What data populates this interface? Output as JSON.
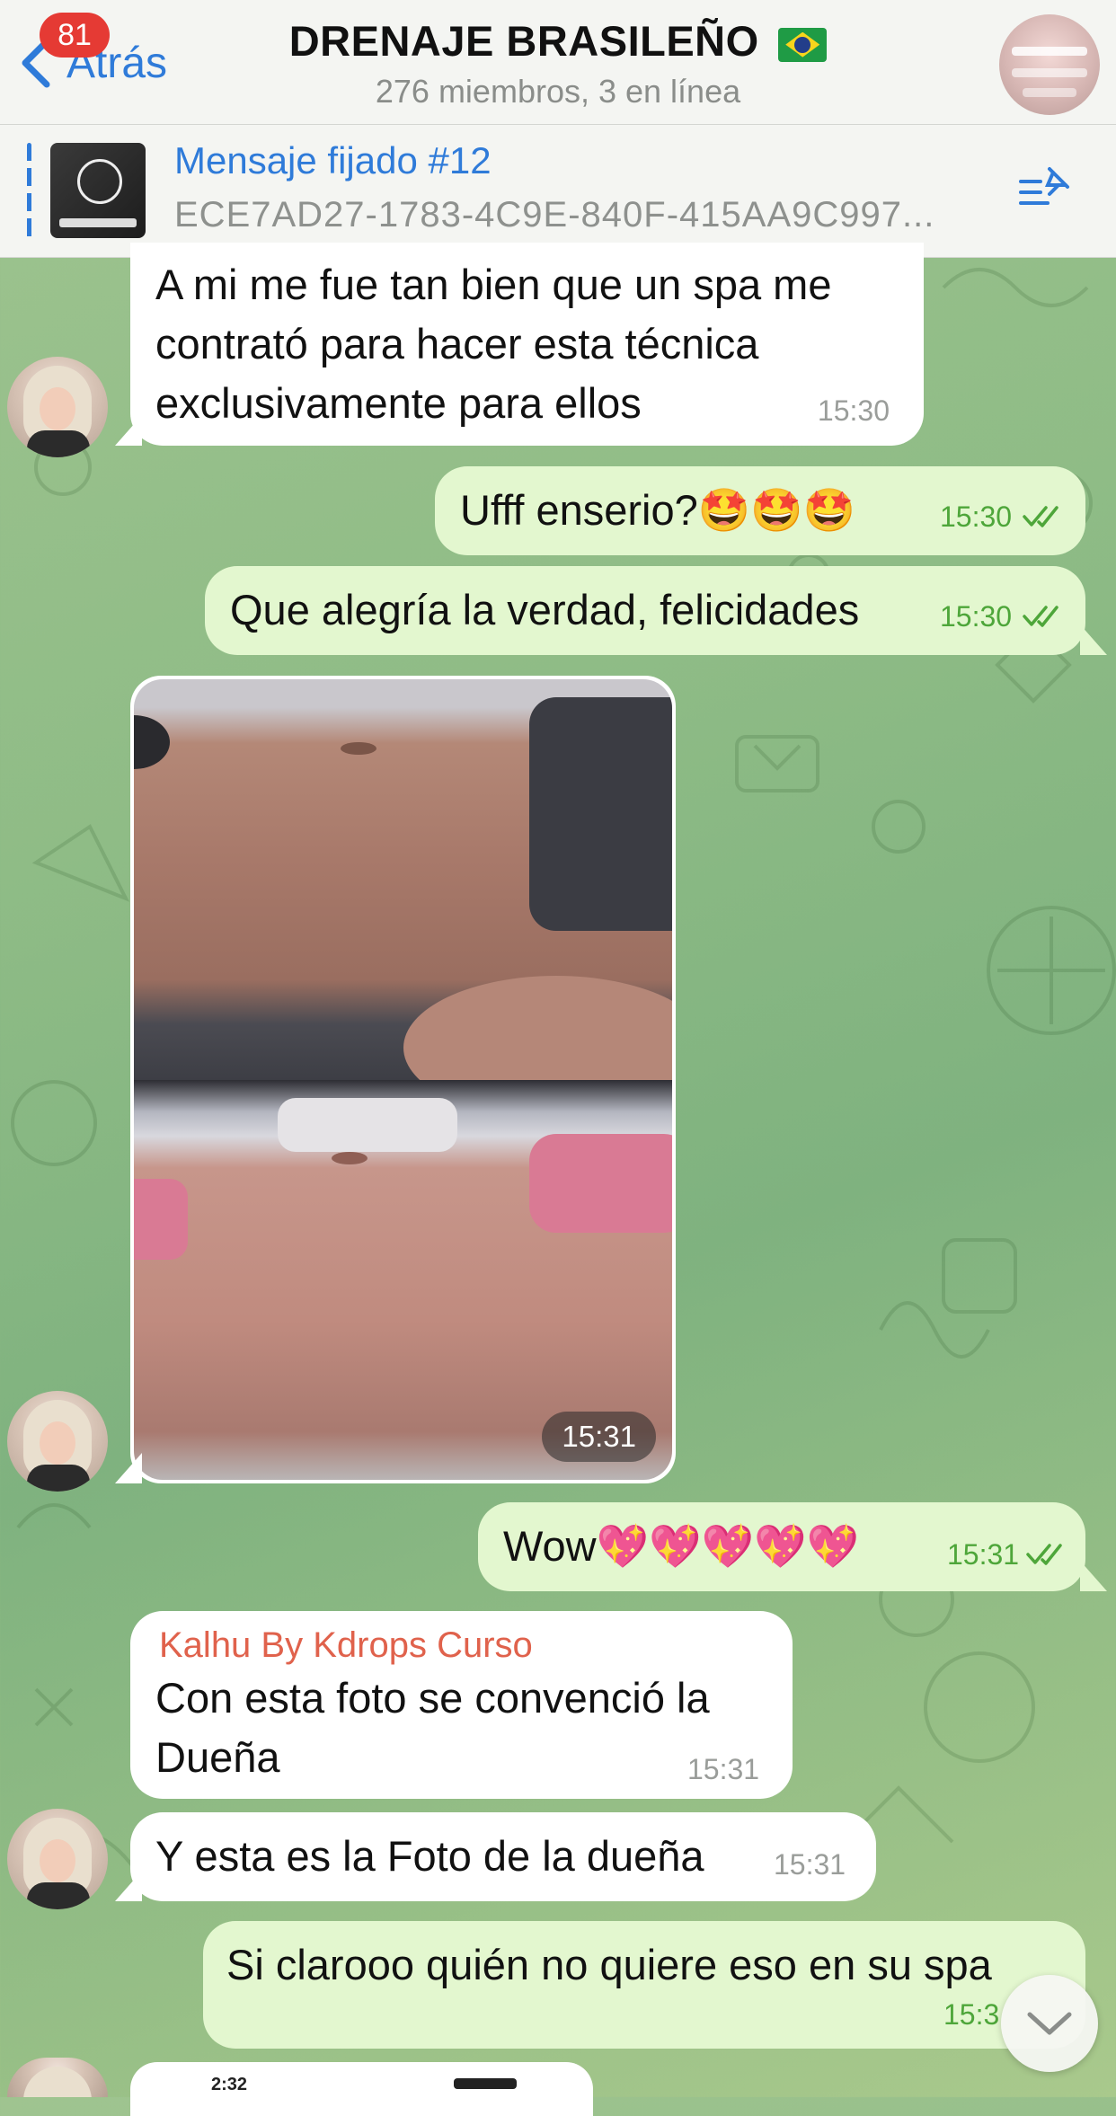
{
  "header": {
    "back_label": "Atrás",
    "unread_badge": "81",
    "title": "DRENAJE BRASILEÑO",
    "title_flag": "brazil-flag",
    "subtitle": "276 miembros, 3 en línea"
  },
  "pinned": {
    "title": "Mensaje fijado #12",
    "text": "ECE7AD27-1783-4C9E-840F-415AA9C997..."
  },
  "messages": [
    {
      "direction": "in",
      "text": "A mi me fue tan bien que un spa me contrató para hacer esta técnica exclusivamente para ellos",
      "lines": [
        "A mi me fue tan bien que un spa me",
        "contrató para hacer esta técnica",
        "exclusivamente para ellos"
      ],
      "time": "15:30"
    },
    {
      "direction": "out",
      "text": "Ufff enserio?🤩🤩🤩",
      "time": "15:30",
      "read": true
    },
    {
      "direction": "out",
      "text": "Que alegría la verdad, felicidades",
      "time": "15:30",
      "read": true
    },
    {
      "direction": "in",
      "type": "photo",
      "time": "15:31"
    },
    {
      "direction": "out",
      "text": "Wow💖💖💖💖💖",
      "time": "15:31",
      "read": true
    },
    {
      "direction": "in",
      "sender": "Kalhu By Kdrops Curso",
      "text": "Con esta foto se convenció la Dueña",
      "lines": [
        "Con esta foto se convenció la",
        "Dueña"
      ],
      "time": "15:31"
    },
    {
      "direction": "in",
      "text": "Y esta es la Foto de la dueña",
      "time": "15:31"
    },
    {
      "direction": "out",
      "text": "Si clarooo quién no quiere eso en su spa",
      "time": "15:3",
      "read": true
    }
  ],
  "peek": {
    "time": "2:32"
  },
  "colors": {
    "accent": "#2f7bd9",
    "badge": "#e53a34",
    "outgoing": "#e3f7cf",
    "incoming": "#ffffff",
    "sender": "#e0624c",
    "check": "#4ea63a"
  }
}
